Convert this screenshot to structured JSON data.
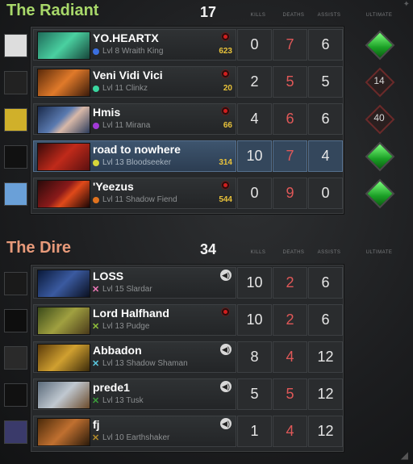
{
  "radiant": {
    "name": "The Radiant",
    "score": "17",
    "color": "#a8d86a",
    "headers": {
      "kills": "KILLS",
      "deaths": "DEATHS",
      "assists": "ASSISTS",
      "ultimate": "ULTIMATE"
    },
    "players": [
      {
        "name": "YO.HEARTX",
        "info": "Lvl 8 Wraith King",
        "gold": "623",
        "kills": "0",
        "deaths": "7",
        "assists": "6",
        "ult": "",
        "dot_color": "#3b6fe0",
        "status_icon": "record-icon"
      },
      {
        "name": "Veni Vidi Vici",
        "info": "Lvl 11 Clinkz",
        "gold": "20",
        "kills": "2",
        "deaths": "5",
        "assists": "5",
        "ult": "14",
        "dot_color": "#3ad6a0",
        "status_icon": "record-icon"
      },
      {
        "name": "Hmis",
        "info": "Lvl 11 Mirana",
        "gold": "66",
        "kills": "4",
        "deaths": "6",
        "assists": "6",
        "ult": "40",
        "dot_color": "#a23ad6",
        "status_icon": "record-icon"
      },
      {
        "name": "road to nowhere",
        "info": "Lvl 13 Bloodseeker",
        "gold": "314",
        "kills": "10",
        "deaths": "7",
        "assists": "4",
        "ult": "",
        "dot_color": "#d6d63a",
        "status_icon": "none"
      },
      {
        "name": "'Yeezus",
        "info": "Lvl 11 Shadow Fiend",
        "gold": "544",
        "kills": "0",
        "deaths": "9",
        "assists": "0",
        "ult": "",
        "dot_color": "#e0731f",
        "status_icon": "record-icon"
      }
    ]
  },
  "dire": {
    "name": "The Dire",
    "score": "34",
    "color": "#e89a7a",
    "headers": {
      "kills": "KILLS",
      "deaths": "DEATHS",
      "assists": "ASSISTS",
      "ultimate": "ULTIMATE"
    },
    "players": [
      {
        "name": "LOSS",
        "info": "Lvl 15 Slardar",
        "kills": "10",
        "deaths": "2",
        "assists": "6",
        "mark_color": "#f07ab8",
        "status_icon": "speaker-icon"
      },
      {
        "name": "Lord Halfhand",
        "info": "Lvl 13 Pudge",
        "kills": "10",
        "deaths": "2",
        "assists": "6",
        "mark_color": "#8fbf3a",
        "status_icon": "record-icon"
      },
      {
        "name": "Abbadon",
        "info": "Lvl 13 Shadow Shaman",
        "kills": "8",
        "deaths": "4",
        "assists": "12",
        "mark_color": "#5ac8e0",
        "status_icon": "speaker-icon"
      },
      {
        "name": "prede1",
        "info": "Lvl 13 Tusk",
        "kills": "5",
        "deaths": "5",
        "assists": "12",
        "mark_color": "#3a9e3a",
        "status_icon": "speaker-icon"
      },
      {
        "name": "fj",
        "info": "Lvl 10 Earthshaker",
        "kills": "1",
        "deaths": "4",
        "assists": "12",
        "mark_color": "#b08a2a",
        "status_icon": "speaker-icon"
      }
    ]
  },
  "ultimate_states": [
    "ready",
    "14",
    "40",
    "ready",
    "ready"
  ],
  "speaker_glyph": "◀)",
  "x_glyph": "✕"
}
